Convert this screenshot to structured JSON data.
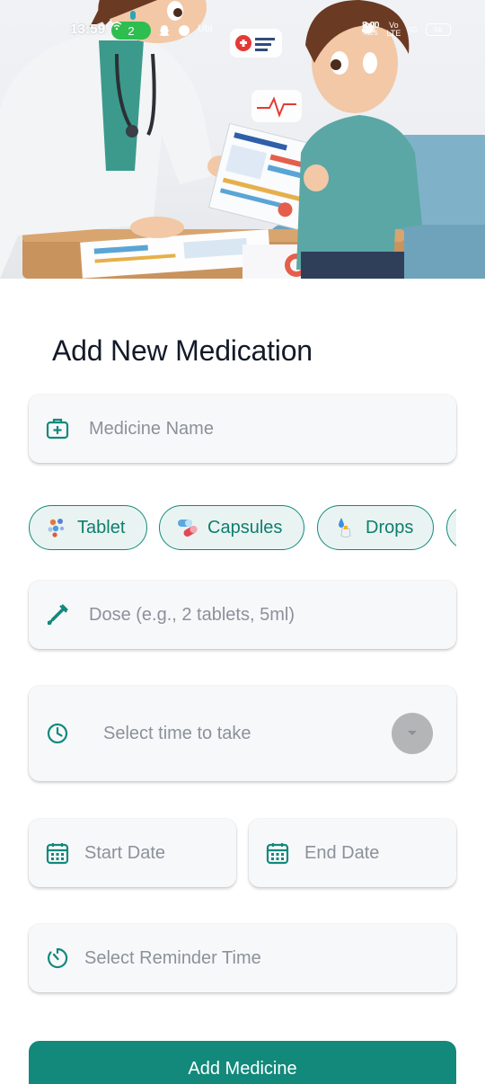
{
  "status_bar": {
    "time": "13:59",
    "hotspot_count": "2",
    "small_label": "Ubi",
    "net_speed_value": "8.00",
    "net_speed_unit": "KB/S",
    "volte_top": "Vo",
    "volte_bottom": "LTE",
    "signal": "5G",
    "battery": "56"
  },
  "hero": {
    "illustration": "doctor-and-patient-reviewing-medical-report"
  },
  "form": {
    "title": "Add New Medication",
    "medicine_name": {
      "placeholder": "Medicine Name",
      "icon": "medical-kit-icon"
    },
    "types": [
      {
        "label": "Tablet",
        "icon": "tablet-icon"
      },
      {
        "label": "Capsules",
        "icon": "capsule-icon"
      },
      {
        "label": "Drops",
        "icon": "drops-icon"
      }
    ],
    "dose": {
      "placeholder": "Dose (e.g., 2 tablets, 5ml)",
      "icon": "dropper-icon"
    },
    "time": {
      "placeholder": "Select time to take",
      "icon": "clock-icon"
    },
    "start_date": {
      "placeholder": "Start Date",
      "icon": "calendar-icon"
    },
    "end_date": {
      "placeholder": "End Date",
      "icon": "calendar-icon"
    },
    "reminder": {
      "placeholder": "Select Reminder Time",
      "icon": "timer-icon"
    },
    "submit_label": "Add Medicine"
  },
  "colors": {
    "accent": "#12897b",
    "chip_bg": "#e9f4f2",
    "field_bg": "#f7f8fa",
    "placeholder": "#8b919a",
    "title": "#131a28"
  }
}
